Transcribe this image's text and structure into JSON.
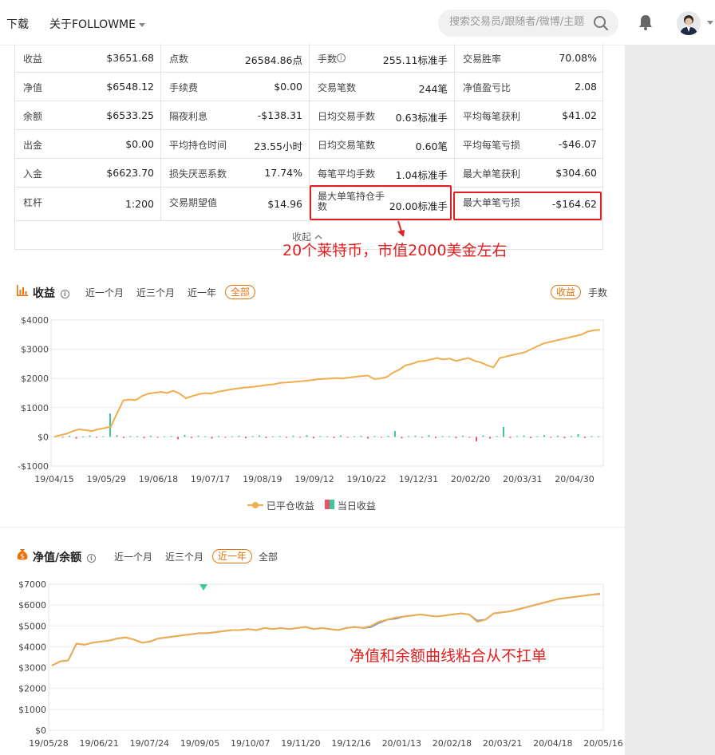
{
  "header": {
    "nav": [
      "下载",
      "关于FOLLOWME"
    ],
    "search_placeholder": "搜索交易员/跟随者/微博/主题"
  },
  "stats": [
    [
      {
        "label": "收益",
        "value": "$3651.68"
      },
      {
        "label": "点数",
        "value": "26584.86点"
      },
      {
        "label": "手数",
        "value": "255.11标准手",
        "info": true
      },
      {
        "label": "交易胜率",
        "value": "70.08%"
      }
    ],
    [
      {
        "label": "净值",
        "value": "$6548.12"
      },
      {
        "label": "手续费",
        "value": "$0.00"
      },
      {
        "label": "交易笔数",
        "value": "244笔"
      },
      {
        "label": "净值盈亏比",
        "value": "2.08"
      }
    ],
    [
      {
        "label": "余额",
        "value": "$6533.25"
      },
      {
        "label": "隔夜利息",
        "value": "-$138.31"
      },
      {
        "label": "日均交易手数",
        "value": "0.63标准手"
      },
      {
        "label": "平均每笔获利",
        "value": "$41.02"
      }
    ],
    [
      {
        "label": "出金",
        "value": "$0.00"
      },
      {
        "label": "平均持仓时间",
        "value": "23.55小时"
      },
      {
        "label": "日均交易笔数",
        "value": "0.60笔"
      },
      {
        "label": "平均每笔亏损",
        "value": "-$46.07"
      }
    ],
    [
      {
        "label": "入金",
        "value": "$6623.70"
      },
      {
        "label": "损失厌恶系数",
        "value": "17.74%"
      },
      {
        "label": "每笔平均手数",
        "value": "1.04标准手"
      },
      {
        "label": "最大单笔获利",
        "value": "$304.60"
      }
    ],
    [
      {
        "label": "杠杆",
        "value": "1:200"
      },
      {
        "label": "交易期望值",
        "value": "$14.96"
      },
      {
        "label": "最大单笔持仓手数",
        "value": "20.00标准手"
      },
      {
        "label": "最大单笔亏损",
        "value": "-$164.62"
      }
    ]
  ],
  "collapse_label": "收起",
  "annotations": {
    "litecoin": "20个莱特币，市值2000美金左右",
    "equity": "净值和余额曲线粘合从不扛单"
  },
  "profit_section": {
    "title": "收益",
    "periods": [
      "近一个月",
      "近三个月",
      "近一年",
      "全部"
    ],
    "active_period": 3,
    "toggles": [
      "收益",
      "手数"
    ],
    "legend": [
      "已平仓收益",
      "当日收益"
    ]
  },
  "equity_section": {
    "title": "净值/余额",
    "periods": [
      "近一个月",
      "近三个月",
      "近一年",
      "全部"
    ],
    "active_period": 2
  },
  "colors": {
    "line": "#f0ad4e",
    "up": "#3cc8a0",
    "down": "#e8546a",
    "balance": "#6e8fd6",
    "accent": "#e9740f"
  },
  "chart_data": [
    {
      "type": "line",
      "title": "收益",
      "y_ticks": [
        "$4000",
        "$3000",
        "$2000",
        "$1000",
        "$0",
        "-$1000"
      ],
      "ylim": [
        -1000,
        4000
      ],
      "x_ticks": [
        "19/04/15",
        "19/05/29",
        "19/06/18",
        "19/07/17",
        "19/08/19",
        "19/09/12",
        "19/10/22",
        "19/12/31",
        "20/02/20",
        "20/03/31",
        "20/04/30"
      ],
      "series": [
        {
          "name": "已平仓收益",
          "values": [
            0,
            60,
            110,
            200,
            260,
            230,
            200,
            260,
            300,
            350,
            800,
            1250,
            1280,
            1260,
            1400,
            1480,
            1510,
            1540,
            1500,
            1580,
            1480,
            1320,
            1400,
            1460,
            1500,
            1480,
            1540,
            1580,
            1620,
            1650,
            1680,
            1700,
            1720,
            1750,
            1780,
            1800,
            1850,
            1860,
            1880,
            1900,
            1920,
            1940,
            1970,
            1990,
            2000,
            2010,
            2000,
            2030,
            2060,
            2080,
            2100,
            1980,
            2000,
            2050,
            2200,
            2300,
            2450,
            2500,
            2580,
            2600,
            2650,
            2700,
            2650,
            2680,
            2600,
            2650,
            2700,
            2600,
            2550,
            2450,
            2380,
            2700,
            2750,
            2800,
            2850,
            2900,
            3000,
            3100,
            3200,
            3250,
            3300,
            3350,
            3400,
            3450,
            3500,
            3600,
            3650,
            3660
          ]
        },
        {
          "name": "当日收益",
          "values": [
            30,
            -20,
            40,
            -60,
            10,
            50,
            -30,
            20,
            800,
            60,
            -40,
            30,
            20,
            -50,
            40,
            -30,
            20,
            30,
            -80,
            70,
            -40,
            40,
            20,
            -60,
            30,
            -30,
            20,
            40,
            -50,
            30,
            50,
            -40,
            20,
            30,
            -30,
            40,
            -20,
            60,
            -50,
            30,
            20,
            -40,
            50,
            -30,
            20,
            40,
            -60,
            30,
            -20,
            40,
            200,
            -50,
            30,
            40,
            -30,
            60,
            -40,
            30,
            20,
            -50,
            40,
            -30,
            -150,
            50,
            -60,
            30,
            340,
            -40,
            30,
            50,
            -40,
            20,
            60,
            -30,
            40,
            -50,
            30,
            90,
            -40,
            30,
            20
          ]
        }
      ]
    },
    {
      "type": "line",
      "title": "净值/余额",
      "y_ticks": [
        "$7000",
        "$6000",
        "$5000",
        "$4000",
        "$3000",
        "$2000",
        "$1000",
        "$0"
      ],
      "ylim": [
        0,
        7000
      ],
      "x_ticks": [
        "19/05/28",
        "19/06/21",
        "19/07/24",
        "19/09/05",
        "19/10/07",
        "19/11/20",
        "19/12/16",
        "20/01/13",
        "20/02/18",
        "20/03/21",
        "20/04/18",
        "20/05/16"
      ],
      "series": [
        {
          "name": "净值",
          "values": [
            3100,
            3300,
            3350,
            4150,
            4100,
            4200,
            4250,
            4300,
            4400,
            4450,
            4350,
            4200,
            4250,
            4400,
            4450,
            4500,
            4550,
            4600,
            4650,
            4650,
            4700,
            4750,
            4800,
            4800,
            4850,
            4800,
            4900,
            4850,
            4900,
            4850,
            4900,
            4950,
            4850,
            4900,
            4850,
            4800,
            4900,
            4950,
            4900,
            5000,
            5200,
            5300,
            5400,
            5450,
            5500,
            5550,
            5500,
            5450,
            5500,
            5550,
            5600,
            5550,
            5200,
            5300,
            5600,
            5650,
            5700,
            5800,
            5900,
            6000,
            6100,
            6200,
            6300,
            6350,
            6400,
            6450,
            6500,
            6550
          ]
        },
        {
          "name": "余额",
          "values": [
            3100,
            3300,
            3350,
            4150,
            4100,
            4200,
            4250,
            4300,
            4400,
            4450,
            4350,
            4200,
            4250,
            4400,
            4450,
            4500,
            4550,
            4600,
            4650,
            4650,
            4700,
            4750,
            4800,
            4800,
            4850,
            4800,
            4900,
            4850,
            4900,
            4850,
            4900,
            4950,
            4850,
            4900,
            4850,
            4800,
            4900,
            4950,
            4900,
            4950,
            5150,
            5300,
            5350,
            5450,
            5500,
            5550,
            5500,
            5450,
            5500,
            5550,
            5600,
            5550,
            5250,
            5300,
            5600,
            5650,
            5700,
            5800,
            5900,
            6000,
            6100,
            6200,
            6300,
            6350,
            6400,
            6450,
            6500,
            6533
          ]
        }
      ]
    }
  ]
}
